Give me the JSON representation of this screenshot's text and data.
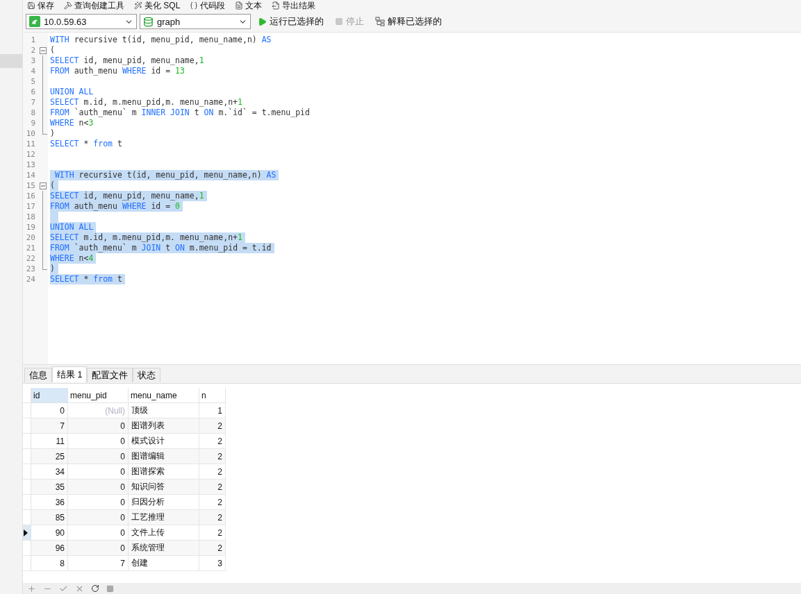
{
  "toolbar": [
    "保存",
    "查询创建工具",
    "美化 SQL",
    "代码段",
    "文本",
    "导出结果"
  ],
  "connection": {
    "value": "10.0.59.63"
  },
  "database": {
    "value": "graph"
  },
  "actions": [
    {
      "label": "运行已选择的",
      "kind": "run",
      "disabled": false
    },
    {
      "label": "停止",
      "kind": "stop",
      "disabled": true
    },
    {
      "label": "解释已选择的",
      "kind": "explain",
      "disabled": false
    }
  ],
  "editor": {
    "lines": [
      {
        "no": "1",
        "kind": "plain",
        "selected": false,
        "tokens": [
          {
            "text": "WITH",
            "kind": "keyword"
          },
          {
            "text": " recursive t(id, menu_pid, menu_name,n) ",
            "kind": "plain"
          },
          {
            "text": "AS",
            "kind": "keyword"
          }
        ]
      },
      {
        "no": "2",
        "kind": "start",
        "selected": false,
        "tokens": [
          {
            "text": "(",
            "kind": "plain"
          }
        ]
      },
      {
        "no": "3",
        "kind": "inner",
        "selected": false,
        "tokens": [
          {
            "text": "SELECT",
            "kind": "keyword"
          },
          {
            "text": " id, menu_pid, menu_name,",
            "kind": "plain"
          },
          {
            "text": "1",
            "kind": "number"
          }
        ]
      },
      {
        "no": "4",
        "kind": "inner",
        "selected": false,
        "tokens": [
          {
            "text": "FROM",
            "kind": "keyword"
          },
          {
            "text": " auth_menu ",
            "kind": "plain"
          },
          {
            "text": "WHERE",
            "kind": "keyword"
          },
          {
            "text": " id = ",
            "kind": "plain"
          },
          {
            "text": "13",
            "kind": "number"
          }
        ]
      },
      {
        "no": "5",
        "kind": "inner",
        "selected": false
      },
      {
        "no": "6",
        "kind": "inner",
        "selected": false,
        "tokens": [
          {
            "text": "UNION ALL",
            "kind": "keyword"
          }
        ]
      },
      {
        "no": "7",
        "kind": "inner",
        "selected": false,
        "tokens": [
          {
            "text": "SELECT",
            "kind": "keyword"
          },
          {
            "text": " m.id, m.menu_pid,m. menu_name,n+",
            "kind": "plain"
          },
          {
            "text": "1",
            "kind": "number"
          }
        ]
      },
      {
        "no": "8",
        "kind": "inner",
        "selected": false,
        "tokens": [
          {
            "text": "FROM",
            "kind": "keyword"
          },
          {
            "text": " `auth_menu` m ",
            "kind": "plain"
          },
          {
            "text": "INNER JOIN",
            "kind": "keyword"
          },
          {
            "text": " t ",
            "kind": "plain"
          },
          {
            "text": "ON",
            "kind": "keyword"
          },
          {
            "text": " m.`id` = t.menu_pid",
            "kind": "plain"
          }
        ]
      },
      {
        "no": "9",
        "kind": "inner",
        "selected": false,
        "tokens": [
          {
            "text": "WHERE",
            "kind": "keyword"
          },
          {
            "text": " n<",
            "kind": "plain"
          },
          {
            "text": "3",
            "kind": "number"
          }
        ]
      },
      {
        "no": "10",
        "kind": "end",
        "selected": false,
        "tokens": [
          {
            "text": ")",
            "kind": "plain"
          }
        ]
      },
      {
        "no": "11",
        "kind": "plain",
        "selected": false,
        "tokens": [
          {
            "text": "SELECT",
            "kind": "keyword"
          },
          {
            "text": " * ",
            "kind": "plain"
          },
          {
            "text": "from",
            "kind": "keyword"
          },
          {
            "text": " t",
            "kind": "plain"
          }
        ]
      },
      {
        "no": "12",
        "kind": "plain",
        "selected": false
      },
      {
        "no": "13",
        "kind": "plain",
        "selected": false
      },
      {
        "no": "14",
        "kind": "plain",
        "selected": true,
        "tokens": [
          {
            "text": " WITH",
            "kind": "keyword"
          },
          {
            "text": " recursive t(id, menu_pid, menu_name,n) ",
            "kind": "plain"
          },
          {
            "text": "AS",
            "kind": "keyword"
          }
        ]
      },
      {
        "no": "15",
        "kind": "start",
        "selected": true,
        "tokens": [
          {
            "text": "(",
            "kind": "plain"
          }
        ]
      },
      {
        "no": "16",
        "kind": "inner",
        "selected": true,
        "tokens": [
          {
            "text": "SELECT",
            "kind": "keyword"
          },
          {
            "text": " id, menu_pid, menu_name,",
            "kind": "plain"
          },
          {
            "text": "1",
            "kind": "number"
          }
        ]
      },
      {
        "no": "17",
        "kind": "inner",
        "selected": true,
        "tokens": [
          {
            "text": "FROM",
            "kind": "keyword"
          },
          {
            "text": " auth_menu ",
            "kind": "plain"
          },
          {
            "text": "WHERE",
            "kind": "keyword"
          },
          {
            "text": " id = ",
            "kind": "plain"
          },
          {
            "text": "0",
            "kind": "number"
          }
        ]
      },
      {
        "no": "18",
        "kind": "inner",
        "selected": true
      },
      {
        "no": "19",
        "kind": "inner",
        "selected": true,
        "tokens": [
          {
            "text": "UNION ALL",
            "kind": "keyword"
          }
        ]
      },
      {
        "no": "20",
        "kind": "inner",
        "selected": true,
        "tokens": [
          {
            "text": "SELECT",
            "kind": "keyword"
          },
          {
            "text": " m.id, m.menu_pid,m. menu_name,n+",
            "kind": "plain"
          },
          {
            "text": "1",
            "kind": "number"
          }
        ]
      },
      {
        "no": "21",
        "kind": "inner",
        "selected": true,
        "tokens": [
          {
            "text": "FROM",
            "kind": "keyword"
          },
          {
            "text": " `auth_menu` m ",
            "kind": "plain"
          },
          {
            "text": "JOIN",
            "kind": "keyword"
          },
          {
            "text": " t ",
            "kind": "plain"
          },
          {
            "text": "ON",
            "kind": "keyword"
          },
          {
            "text": " m.menu_pid = t.id",
            "kind": "plain"
          }
        ]
      },
      {
        "no": "22",
        "kind": "inner",
        "selected": true,
        "tokens": [
          {
            "text": "WHERE",
            "kind": "keyword"
          },
          {
            "text": " n<",
            "kind": "plain"
          },
          {
            "text": "4",
            "kind": "number"
          }
        ]
      },
      {
        "no": "23",
        "kind": "end",
        "selected": true,
        "tokens": [
          {
            "text": ")",
            "kind": "plain"
          }
        ]
      },
      {
        "no": "24",
        "kind": "plain",
        "selected": true,
        "tokens": [
          {
            "text": "SELECT",
            "kind": "keyword"
          },
          {
            "text": " * ",
            "kind": "plain"
          },
          {
            "text": "from",
            "kind": "keyword"
          },
          {
            "text": " t",
            "kind": "plain"
          }
        ]
      }
    ]
  },
  "result_tabs": [
    {
      "label": "信息",
      "selected": false
    },
    {
      "label": "结果 1",
      "selected": true
    },
    {
      "label": "配置文件",
      "selected": false
    },
    {
      "label": "状态",
      "selected": false
    }
  ],
  "table": {
    "columns": [
      {
        "label": "id",
        "selected": true
      },
      {
        "label": "menu_pid",
        "selected": false
      },
      {
        "label": "menu_name",
        "selected": false
      },
      {
        "label": "n",
        "selected": false
      }
    ],
    "rows": [
      {
        "id": "0",
        "menu_pid": "(Null)",
        "is_null": true,
        "menu_name": "顶级",
        "n": "1",
        "current": false
      },
      {
        "id": "7",
        "menu_pid": "0",
        "is_null": false,
        "menu_name": "图谱列表",
        "n": "2",
        "current": false
      },
      {
        "id": "11",
        "menu_pid": "0",
        "is_null": false,
        "menu_name": "模式设计",
        "n": "2",
        "current": false
      },
      {
        "id": "25",
        "menu_pid": "0",
        "is_null": false,
        "menu_name": "图谱编辑",
        "n": "2",
        "current": false
      },
      {
        "id": "34",
        "menu_pid": "0",
        "is_null": false,
        "menu_name": "图谱探索",
        "n": "2",
        "current": false
      },
      {
        "id": "35",
        "menu_pid": "0",
        "is_null": false,
        "menu_name": "知识问答",
        "n": "2",
        "current": false
      },
      {
        "id": "36",
        "menu_pid": "0",
        "is_null": false,
        "menu_name": "归因分析",
        "n": "2",
        "current": false
      },
      {
        "id": "85",
        "menu_pid": "0",
        "is_null": false,
        "menu_name": "工艺推理",
        "n": "2",
        "current": false
      },
      {
        "id": "90",
        "menu_pid": "0",
        "is_null": false,
        "menu_name": "文件上传",
        "n": "2",
        "current": true
      },
      {
        "id": "96",
        "menu_pid": "0",
        "is_null": false,
        "menu_name": "系统管理",
        "n": "2",
        "current": false
      },
      {
        "id": "8",
        "menu_pid": "7",
        "is_null": false,
        "menu_name": "创建",
        "n": "3",
        "current": false
      }
    ]
  }
}
